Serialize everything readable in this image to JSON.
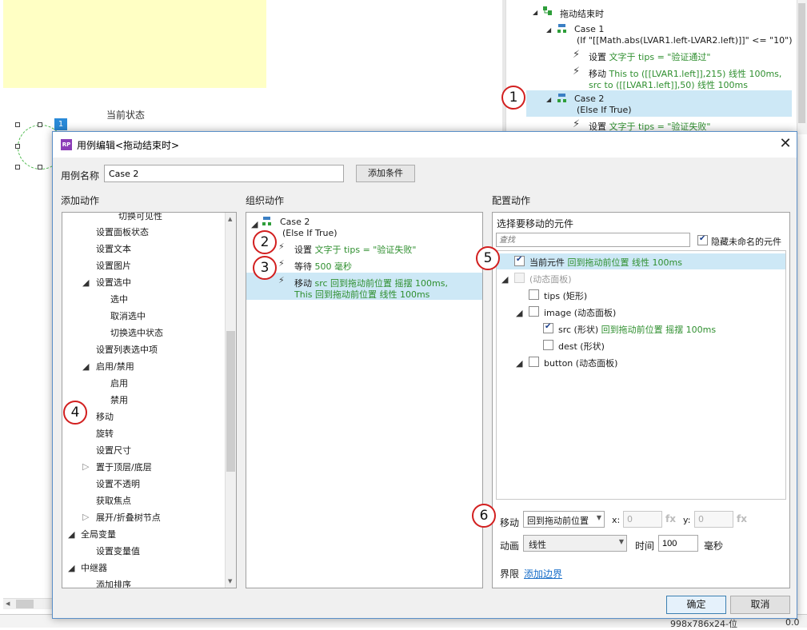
{
  "canvas": {
    "current_state_label": "当前状态",
    "badge": "1",
    "status_size": "998x786x24-位",
    "status_value": "0.0"
  },
  "interactions_panel": {
    "event_name": "拖动结束时",
    "case1": {
      "name": "Case 1",
      "condition": "(If \"[[Math.abs(LVAR1.left-LVAR2.left)]]\" <= \"10\")",
      "action1_verb": "设置",
      "action1_detail": "文字于 tips = \"验证通过\"",
      "action2_verb": "移动",
      "action2_detail_line1": "This to ([[LVAR1.left]],215) 线性 100ms,",
      "action2_detail_line2": "src to ([[LVAR1.left]],50) 线性 100ms"
    },
    "case2": {
      "name": "Case 2",
      "condition": "(Else If True)",
      "action1_verb": "设置",
      "action1_detail": "文字于 tips = \"验证失败\""
    }
  },
  "dialog": {
    "title": "用例编辑<拖动结束时>",
    "case_name_label": "用例名称",
    "case_name_value": "Case 2",
    "add_condition": "添加条件",
    "add_actions_title": "添加动作",
    "organize_title": "组织动作",
    "config_title": "配置动作",
    "ok": "确定",
    "cancel": "取消"
  },
  "add_actions": {
    "items": [
      "切换可见性",
      "设置面板状态",
      "设置文本",
      "设置图片",
      "设置选中",
      "选中",
      "取消选中",
      "切换选中状态",
      "设置列表选中项",
      "启用/禁用",
      "启用",
      "禁用",
      "移动",
      "旋转",
      "设置尺寸",
      "置于顶层/底层",
      "设置不透明",
      "获取焦点",
      "展开/折叠树节点",
      "全局变量",
      "设置变量值",
      "中继器",
      "添加排序"
    ]
  },
  "organize": {
    "case_name": "Case 2",
    "case_condition": "(Else If True)",
    "action1_verb": "设置",
    "action1_detail": "文字于 tips = \"验证失败\"",
    "action2_verb": "等待",
    "action2_detail": "500 毫秒",
    "action3_verb": "移动",
    "action3_detail_line1": "src 回到拖动前位置 摇摆 100ms,",
    "action3_detail_line2": "This 回到拖动前位置 线性 100ms"
  },
  "config": {
    "select_widget_label": "选择要移动的元件",
    "search_placeholder": "查找",
    "hide_unnamed_label": "隐藏未命名的元件",
    "tree": {
      "current_widget": "当前元件",
      "current_widget_action": "回到拖动前位置 线性 100ms",
      "dynamic_panel": "(动态面板)",
      "tips": "tips (矩形)",
      "image": "image (动态面板)",
      "src": "src (形状)",
      "src_action": "回到拖动前位置 摇摆 100ms",
      "dest": "dest (形状)",
      "button": "button (动态面板)"
    },
    "move_label": "移动",
    "move_value": "回到拖动前位置",
    "x_label": "x:",
    "x_value": "0",
    "y_label": "y:",
    "y_value": "0",
    "fx": "fx",
    "animation_label": "动画",
    "animation_value": "线性",
    "time_label": "时间",
    "time_value": "100",
    "ms_label": "毫秒",
    "bound_label": "界限",
    "add_bound_link": "添加边界"
  },
  "markers": [
    "1",
    "2",
    "3",
    "4",
    "5",
    "6"
  ]
}
